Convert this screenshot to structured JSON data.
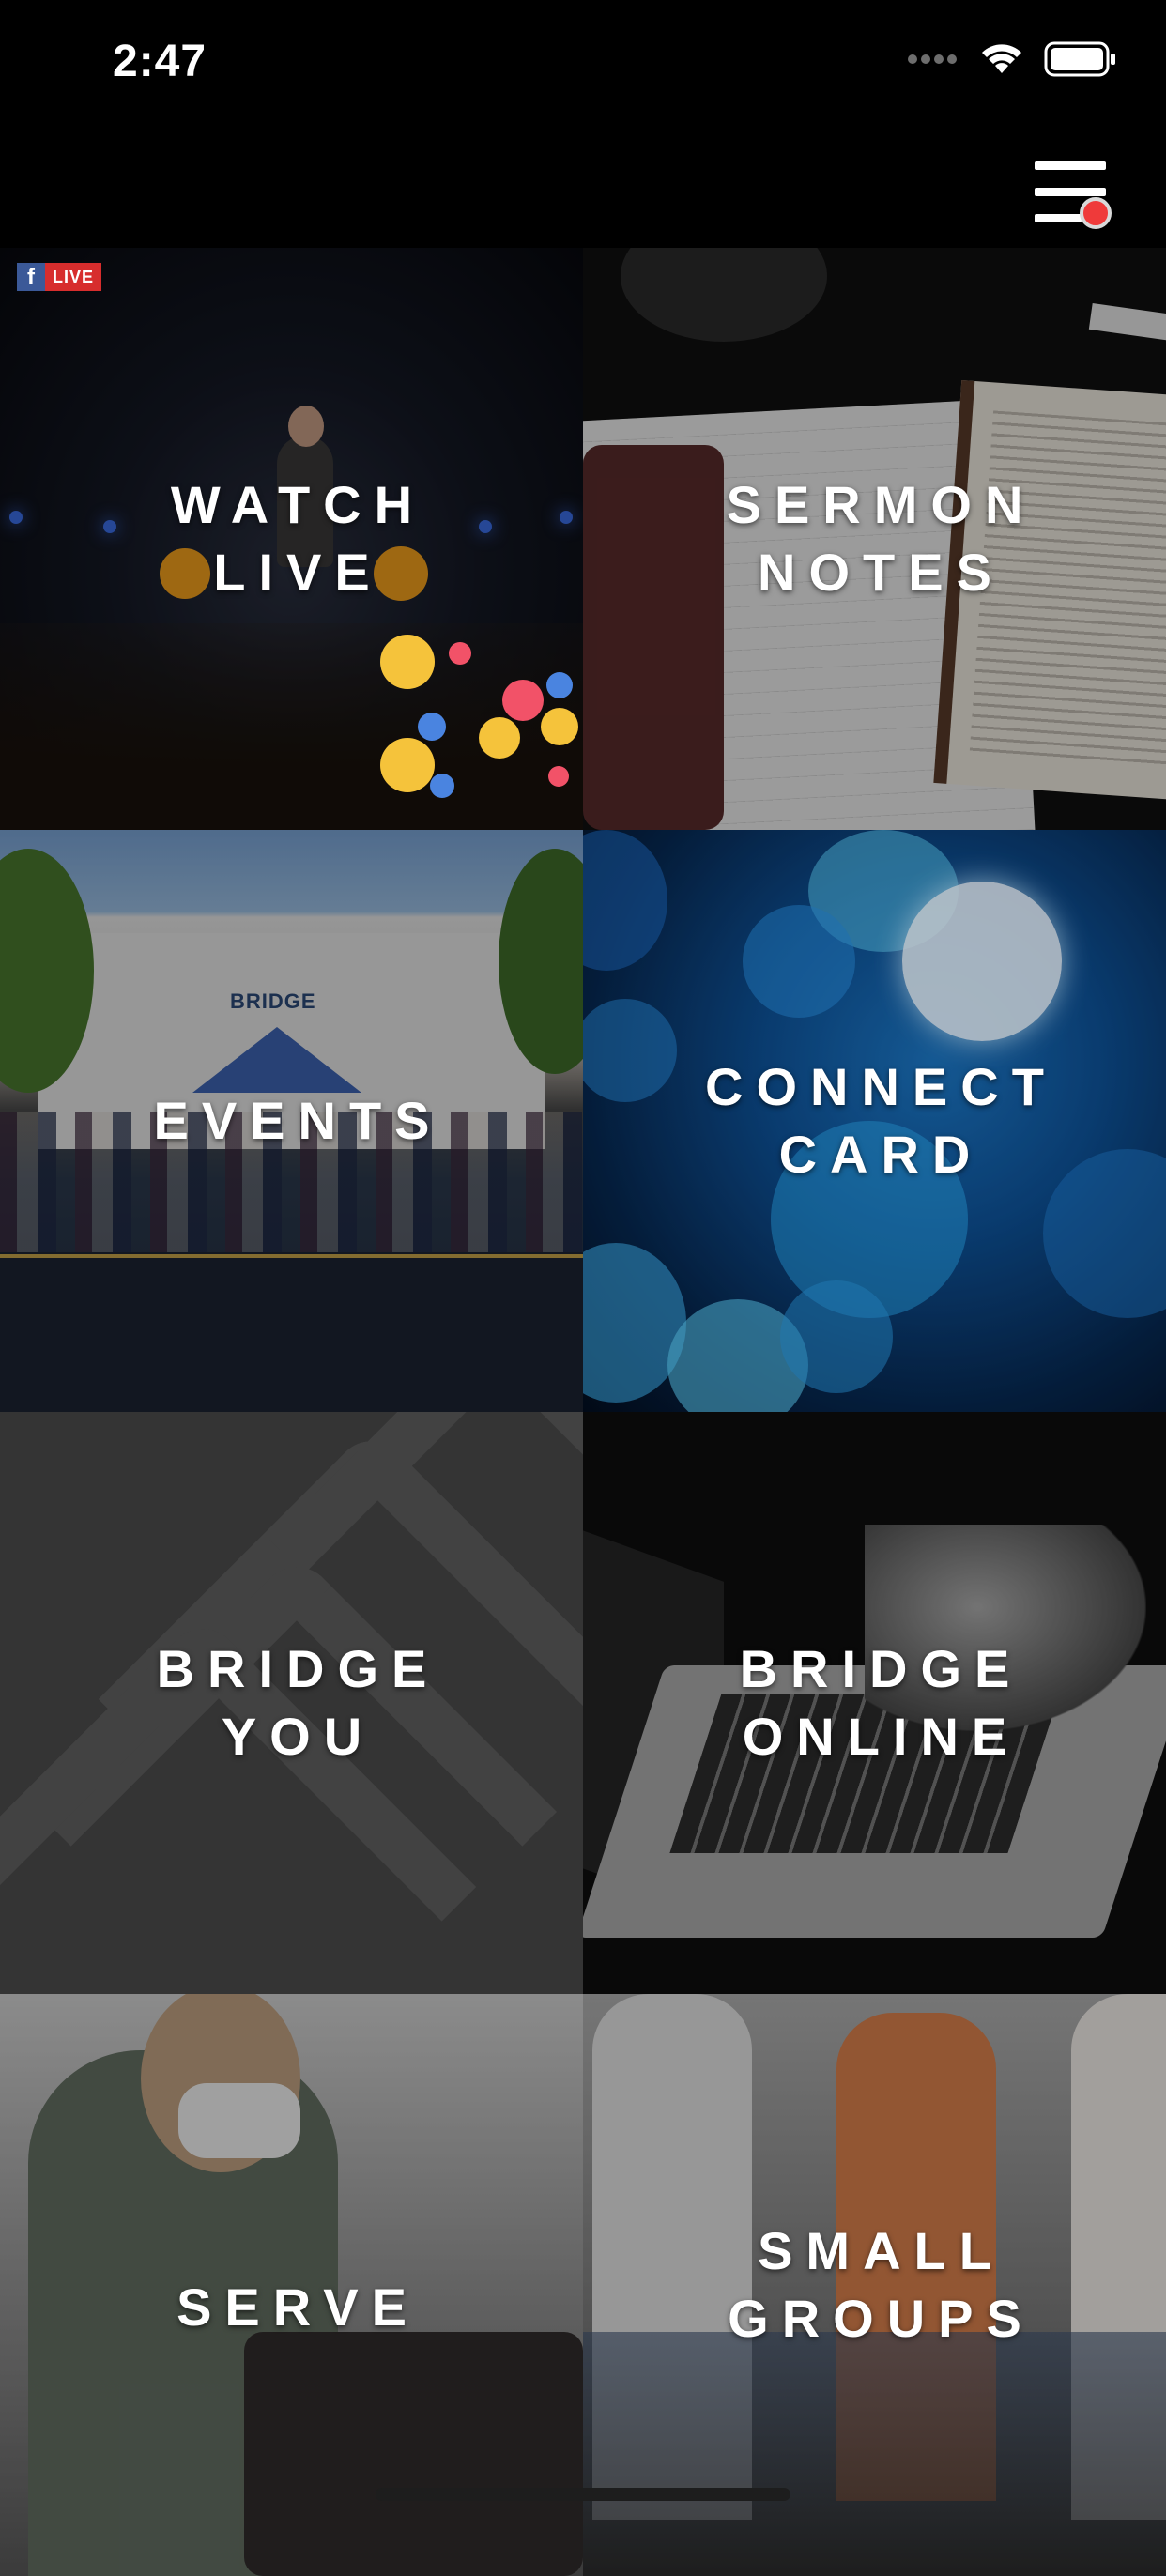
{
  "status_bar": {
    "time": "2:47"
  },
  "tiles": [
    {
      "id": "watch-live",
      "label": "WATCH\nLIVE",
      "badge": "LIVE"
    },
    {
      "id": "sermon-notes",
      "label": "SERMON\nNOTES"
    },
    {
      "id": "events",
      "label": "EVENTS",
      "sign": "BRIDGE"
    },
    {
      "id": "connect-card",
      "label": "CONNECT\nCARD"
    },
    {
      "id": "bridge-you",
      "label": "BRIDGE\nYOU"
    },
    {
      "id": "bridge-online",
      "label": "BRIDGE\nONLINE"
    },
    {
      "id": "serve",
      "label": "SERVE"
    },
    {
      "id": "small-groups",
      "label": "SMALL\nGROUPS"
    }
  ],
  "icons": {
    "menu": "hamburger-menu-icon",
    "notification": "red-dot-badge",
    "signal": "cellular-signal-icon",
    "wifi": "wifi-icon",
    "battery": "battery-icon",
    "facebook": "facebook-icon"
  },
  "colors": {
    "background": "#000000",
    "notification_dot": "#ef3a3a",
    "live_badge": "#d72d2d",
    "facebook_blue": "#3b5998"
  }
}
